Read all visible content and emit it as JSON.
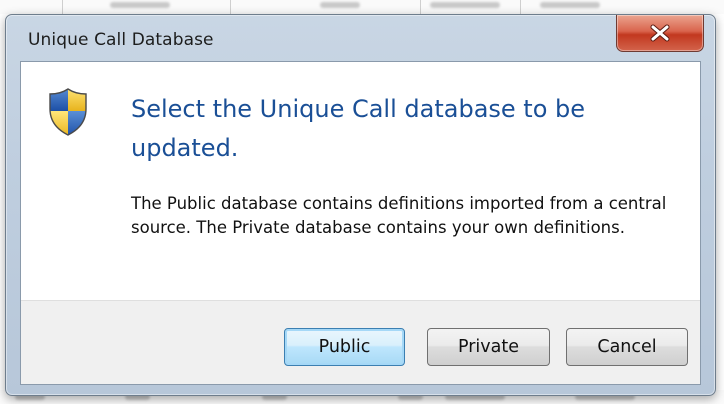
{
  "window": {
    "title": "Unique Call Database"
  },
  "dialog": {
    "main_instruction": "Select the Unique Call database to be updated.",
    "content": "The Public database contains definitions imported from a central source. The Private database contains your own definitions.",
    "icon": "uac-shield-icon"
  },
  "buttons": {
    "public": "Public",
    "private": "Private",
    "cancel": "Cancel",
    "default": "Public"
  },
  "colors": {
    "instruction_text": "#1a4f96",
    "close_button": "#c2381f",
    "frame": "#bfcedf"
  }
}
